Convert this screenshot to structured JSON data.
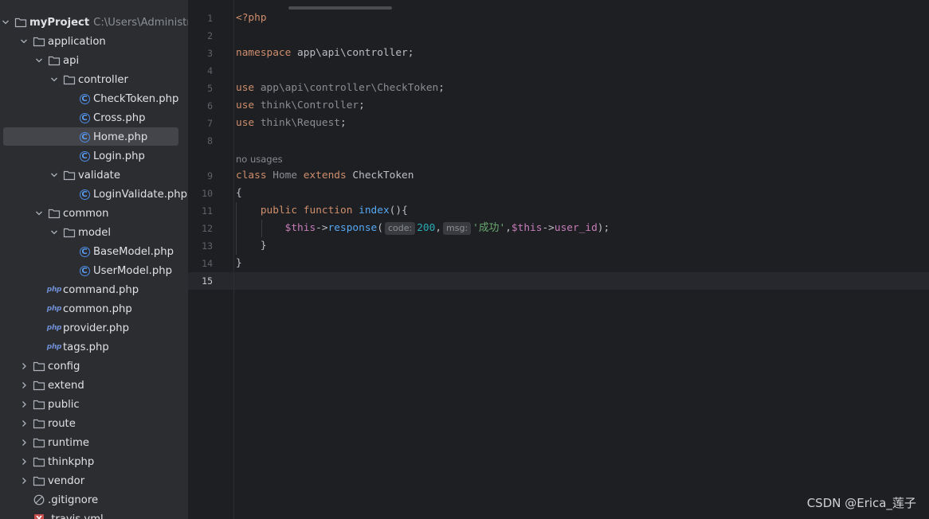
{
  "project": {
    "name": "myProject",
    "path": "C:\\Users\\Administra",
    "items": [
      {
        "label": "application",
        "type": "folder",
        "depth": 1,
        "state": "open"
      },
      {
        "label": "api",
        "type": "folder",
        "depth": 2,
        "state": "open"
      },
      {
        "label": "controller",
        "type": "folder",
        "depth": 3,
        "state": "open"
      },
      {
        "label": "CheckToken.php",
        "type": "class",
        "depth": 4
      },
      {
        "label": "Cross.php",
        "type": "class",
        "depth": 4
      },
      {
        "label": "Home.php",
        "type": "class",
        "depth": 4,
        "selected": true
      },
      {
        "label": "Login.php",
        "type": "class",
        "depth": 4
      },
      {
        "label": "validate",
        "type": "folder",
        "depth": 3,
        "state": "open"
      },
      {
        "label": "LoginValidate.php",
        "type": "class",
        "depth": 4
      },
      {
        "label": "common",
        "type": "folder",
        "depth": 2,
        "state": "open"
      },
      {
        "label": "model",
        "type": "folder",
        "depth": 3,
        "state": "open"
      },
      {
        "label": "BaseModel.php",
        "type": "class",
        "depth": 4
      },
      {
        "label": "UserModel.php",
        "type": "class",
        "depth": 4
      },
      {
        "label": "command.php",
        "type": "php",
        "depth": 2
      },
      {
        "label": "common.php",
        "type": "php",
        "depth": 2
      },
      {
        "label": "provider.php",
        "type": "php",
        "depth": 2
      },
      {
        "label": "tags.php",
        "type": "php",
        "depth": 2
      },
      {
        "label": "config",
        "type": "folder",
        "depth": 1,
        "state": "closed"
      },
      {
        "label": "extend",
        "type": "folder",
        "depth": 1,
        "state": "closed"
      },
      {
        "label": "public",
        "type": "folder",
        "depth": 1,
        "state": "closed"
      },
      {
        "label": "route",
        "type": "folder",
        "depth": 1,
        "state": "closed"
      },
      {
        "label": "runtime",
        "type": "folder",
        "depth": 1,
        "state": "closed"
      },
      {
        "label": "thinkphp",
        "type": "folder",
        "depth": 1,
        "state": "closed"
      },
      {
        "label": "vendor",
        "type": "folder",
        "depth": 1,
        "state": "closed"
      },
      {
        "label": ".gitignore",
        "type": "ignore",
        "depth": 1
      },
      {
        "label": ".travis.yml",
        "type": "yml",
        "depth": 1
      }
    ]
  },
  "editor": {
    "line_numbers": [
      "1",
      "2",
      "3",
      "4",
      "5",
      "6",
      "7",
      "8",
      "9",
      "10",
      "11",
      "12",
      "13",
      "14",
      "15"
    ],
    "current_line": "15",
    "code": {
      "l1_open_tag": "<?php",
      "l3_namespace_kw": "namespace",
      "l3_namespace": " app\\api\\controller;",
      "l5_use_kw": "use",
      "l5_path": " app\\api\\controller\\CheckToken",
      "l5_end": ";",
      "l6_use_kw": "use",
      "l6_path": " think\\Controller",
      "l6_end": ";",
      "l7_use_kw": "use",
      "l7_path": " think\\Request",
      "l7_end": ";",
      "usages_hint": "no usages",
      "l9_class_kw": "class",
      "l9_class_name": " Home ",
      "l9_extends_kw": "extends",
      "l9_parent": " CheckToken",
      "l10_brace": "{",
      "l11_indent": "    ",
      "l11_public_kw": "public",
      "l11_space1": " ",
      "l11_function_kw": "function",
      "l11_space2": " ",
      "l11_fn_name": "index",
      "l11_rest": "(){",
      "l12_indent": "        ",
      "l12_this1": "$this",
      "l12_arrow1": "->",
      "l12_method": "response",
      "l12_paren": "(",
      "l12_hint_code": "code:",
      "l12_num": "200",
      "l12_comma1": ",",
      "l12_hint_msg": "msg:",
      "l12_str": "'成功'",
      "l12_comma2": ",",
      "l12_this2": "$this",
      "l12_arrow2": "->",
      "l12_prop": "user_id",
      "l12_end": ");",
      "l13_close": "    }",
      "l14_close": "}"
    }
  },
  "watermark": "CSDN @Erica_莲子",
  "colors": {
    "tree_bg": "#2b2d30",
    "editor_bg": "#1e1f22",
    "keyword": "#cf8e6d",
    "function": "#56a8f5",
    "variable": "#c77dbb",
    "number": "#2aacb8",
    "string": "#6aab73",
    "folder_icon": "#aeb3bb",
    "class_icon": "#4d8de3"
  }
}
